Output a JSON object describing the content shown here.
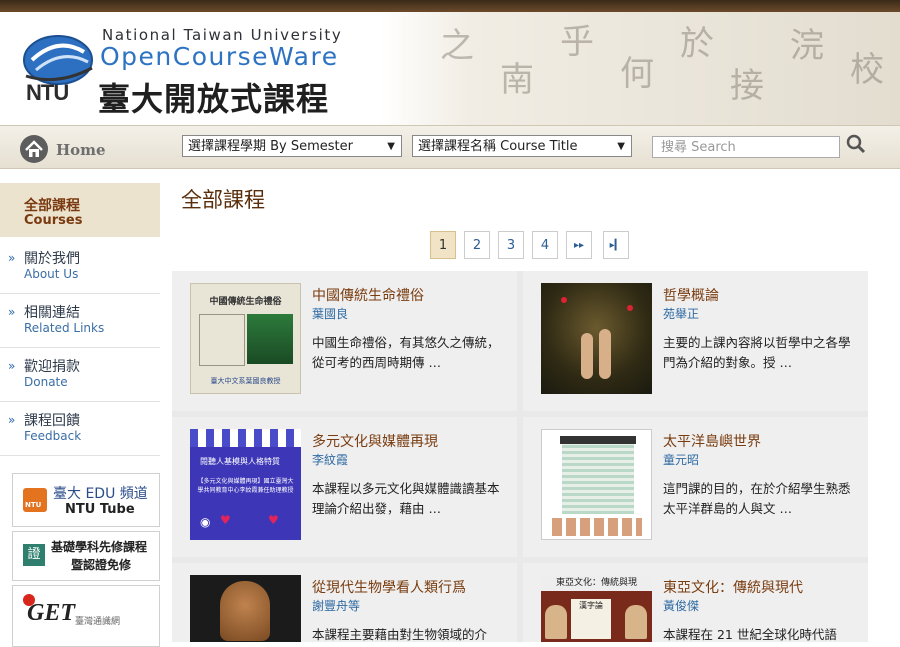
{
  "header": {
    "university_en": "National Taiwan University",
    "ocw_en": "OpenCourseWare",
    "ocw_zh": "臺大開放式課程",
    "logo_text": "NTU"
  },
  "nav": {
    "home_label": "Home",
    "semester_select": "選擇課程學期 By Semester",
    "course_select": "選擇課程名稱 Course Title",
    "search_placeholder": "搜尋 Search"
  },
  "sidebar": {
    "active": {
      "zh": "全部課程",
      "en": "Courses"
    },
    "items": [
      {
        "zh": "關於我們",
        "en": "About Us"
      },
      {
        "zh": "相關連結",
        "en": "Related Links"
      },
      {
        "zh": "歡迎捐款",
        "en": "Donate"
      },
      {
        "zh": "課程回饋",
        "en": "Feedback"
      }
    ],
    "edu_tube": {
      "line1": "臺大 EDU 頻道",
      "line2": "NTU Tube"
    },
    "basic_courses": {
      "line1": "基礎學科先修課程",
      "line2": "暨認證免修",
      "badge": "證"
    },
    "get": {
      "logo": "GET",
      "tagline": "臺灣通識網"
    }
  },
  "main": {
    "title": "全部課程",
    "pagination": [
      "1",
      "2",
      "3",
      "4",
      "▸▸",
      "▸▎"
    ],
    "current_page": "1"
  },
  "courses": [
    {
      "title": "中國傳統生命禮俗",
      "author": "葉國良",
      "desc": "中國生命禮俗，有其悠久之傳統，從可考的西周時期傳 …",
      "thumb_heading": "中國傳統生命禮俗",
      "thumb_caption": "臺大中文系葉國良教授"
    },
    {
      "title": "哲學概論",
      "author": "苑舉正",
      "desc": "主要的上課內容將以哲學中之各學門為介紹的對象。授 …"
    },
    {
      "title": "多元文化與媒體再現",
      "author": "李紋霞",
      "desc": "本課程以多元文化與媒體識讀基本理論介紹出發，藉由 …",
      "thumb_heading": "閱聽人基模與人格特質",
      "thumb_caption": "【多元文化與媒體再現】國立臺灣大學共同教育中心李紋霞兼任助理教授"
    },
    {
      "title": "太平洋島嶼世界",
      "author": "童元昭",
      "desc": "這門課的目的，在於介紹學生熟悉太平洋群島的人與文 …"
    },
    {
      "title": "從現代生物學看人類行爲",
      "author": "謝豐舟等",
      "desc": "本課程主要藉由對生物領域的介"
    },
    {
      "title": "東亞文化：傳統與現代",
      "author": "黃俊傑",
      "desc": "本課程在 21 世紀全球化時代語",
      "thumb_heading": "東亞文化：傳統與現",
      "thumb_book": "漢字論"
    }
  ],
  "colors": {
    "title_brown": "#7a3d10",
    "link_blue": "#2e6aa3",
    "ocw_blue": "#2d73c2",
    "active_bg": "#ece3cf"
  }
}
